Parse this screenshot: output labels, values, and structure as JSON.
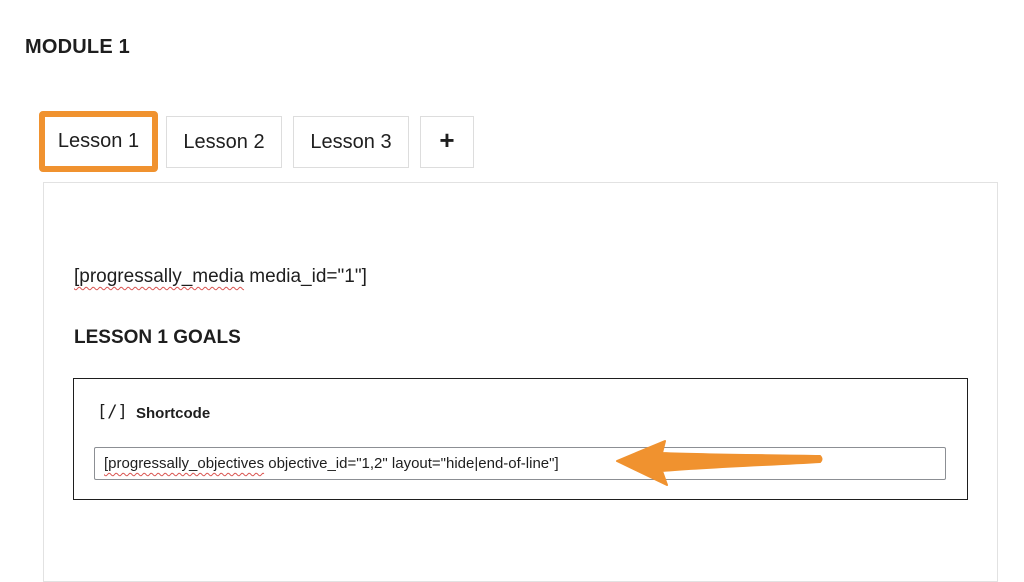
{
  "module": {
    "title": "MODULE 1"
  },
  "tabs": [
    {
      "label": "Lesson 1",
      "active": true
    },
    {
      "label": "Lesson 2",
      "active": false
    },
    {
      "label": "Lesson 3",
      "active": false
    },
    {
      "label": "+",
      "active": false
    }
  ],
  "content": {
    "media_shortcode_name": "[progressally_media",
    "media_shortcode_rest": " media_id=\"1\"]",
    "goals_heading": "LESSON 1 GOALS"
  },
  "shortcode_block": {
    "icon_glyph": "[/]",
    "label": "Shortcode",
    "value_name": "[progressally_objectives",
    "value_rest": " objective_id=\"1,2\" layout=\"hide|end-of-line\"]"
  },
  "colors": {
    "highlight": "#f0922f",
    "spellcheck": "#d9534f",
    "text": "#1e1e1e"
  }
}
